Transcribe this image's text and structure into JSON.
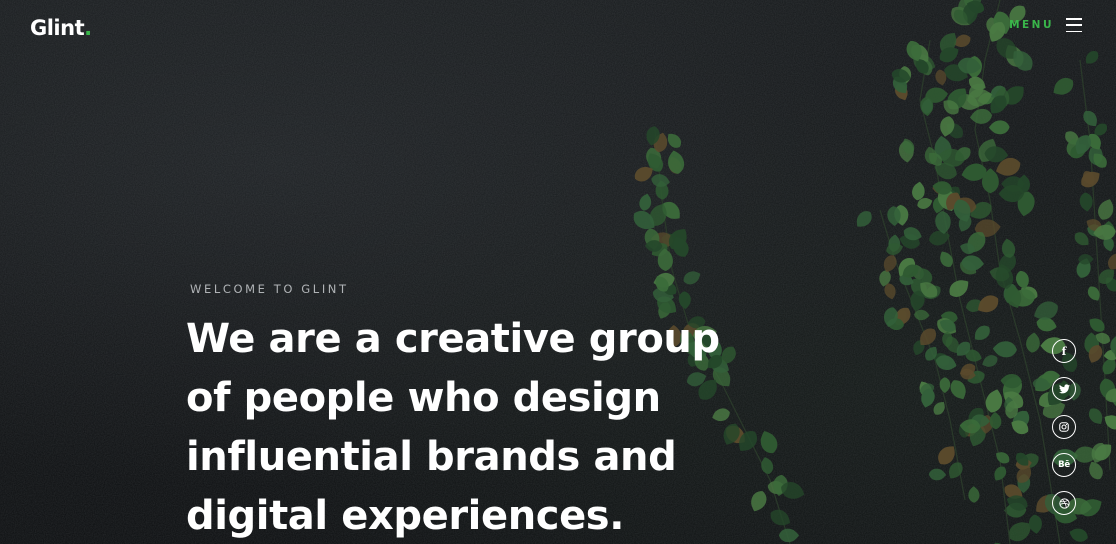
{
  "header": {
    "logo_text": "Glint",
    "logo_dot": ".",
    "menu_label": "MENU"
  },
  "hero": {
    "eyebrow": "WELCOME TO GLINT",
    "headline_lines": [
      "We are a creative group",
      "of people who design",
      "influential brands and",
      "digital experiences."
    ]
  },
  "social": [
    {
      "name": "facebook-icon",
      "glyph": "f"
    },
    {
      "name": "twitter-icon",
      "glyph": ""
    },
    {
      "name": "instagram-icon",
      "glyph": ""
    },
    {
      "name": "behance-icon",
      "glyph": "Bē"
    },
    {
      "name": "dribbble-icon",
      "glyph": ""
    }
  ],
  "colors": {
    "accent": "#39b54a",
    "background": "#0e1012",
    "text": "#ffffff",
    "muted": "#b0b3b6"
  }
}
